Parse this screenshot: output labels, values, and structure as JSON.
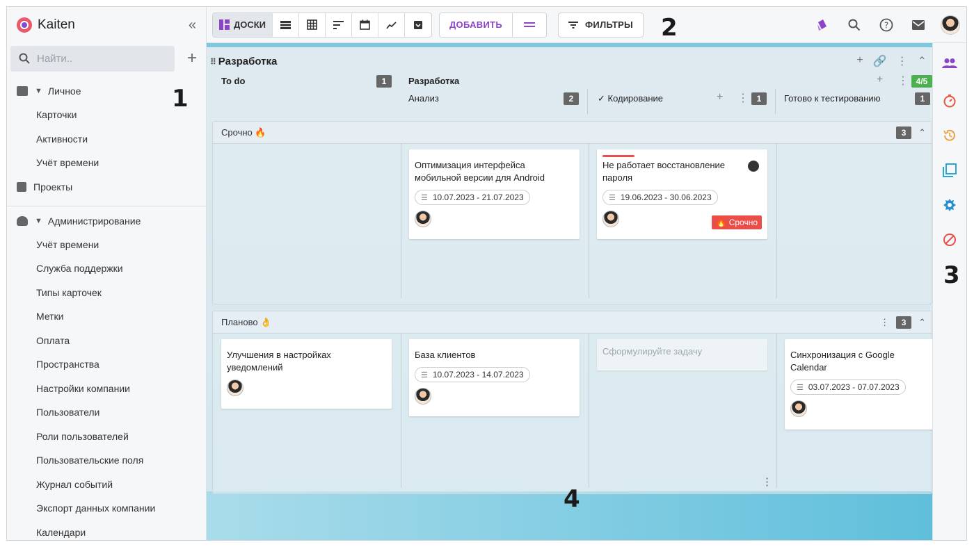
{
  "sidebar": {
    "brand": "Kaiten",
    "search_placeholder": "Найти..",
    "group_personal": "Личное",
    "personal_items": [
      "Карточки",
      "Активности",
      "Учёт времени"
    ],
    "projects": "Проекты",
    "group_admin": "Администрирование",
    "admin_items": [
      "Учёт времени",
      "Служба поддержки",
      "Типы карточек",
      "Метки",
      "Оплата",
      "Пространства",
      "Настройки компании",
      "Пользователи",
      "Роли пользователей",
      "Пользовательские поля",
      "Журнал событий",
      "Экспорт данных компании",
      "Календари"
    ]
  },
  "toolbar": {
    "boards_label": "ДОСКИ",
    "add_label": "ДОБАВИТЬ",
    "filters_label": "ФИЛЬТРЫ"
  },
  "board": {
    "space_title": "Разработка",
    "columns": {
      "todo": {
        "label": "To do",
        "count": "1"
      },
      "dev": {
        "label": "Разработка",
        "wip": "4/5"
      },
      "analysis": {
        "label": "Анализ",
        "count": "2"
      },
      "coding": {
        "label": "Кодирование",
        "count": "1"
      },
      "ready": {
        "label": "Готово к тестированию",
        "count": "1"
      }
    },
    "lanes": [
      {
        "label": "Срочно 🔥",
        "count": "3"
      },
      {
        "label": "Планово 👌",
        "count": "3"
      }
    ],
    "cards": {
      "c1": {
        "title": "Оптимизация интерфейса мобильной версии для Android",
        "dates": "10.07.2023 - 21.07.2023"
      },
      "c2": {
        "title": "Не работает восстановление пароля",
        "dates": "19.06.2023 - 30.06.2023",
        "tag": "🔥 Срочно"
      },
      "c3": {
        "title": "Улучшения в настройках уведомлений"
      },
      "c4": {
        "title": "База клиентов",
        "dates": "10.07.2023 - 14.07.2023"
      },
      "c5": {
        "placeholder": "Сформулируйте задачу"
      },
      "c6": {
        "title": "Синхронизация с Google Calendar",
        "dates": "03.07.2023 - 07.07.2023"
      }
    }
  },
  "annotations": [
    "1",
    "2",
    "3",
    "4"
  ],
  "colors": {
    "accent": "#8e44c9",
    "urgent": "#e94e49",
    "wip_ok": "#4caf50"
  }
}
